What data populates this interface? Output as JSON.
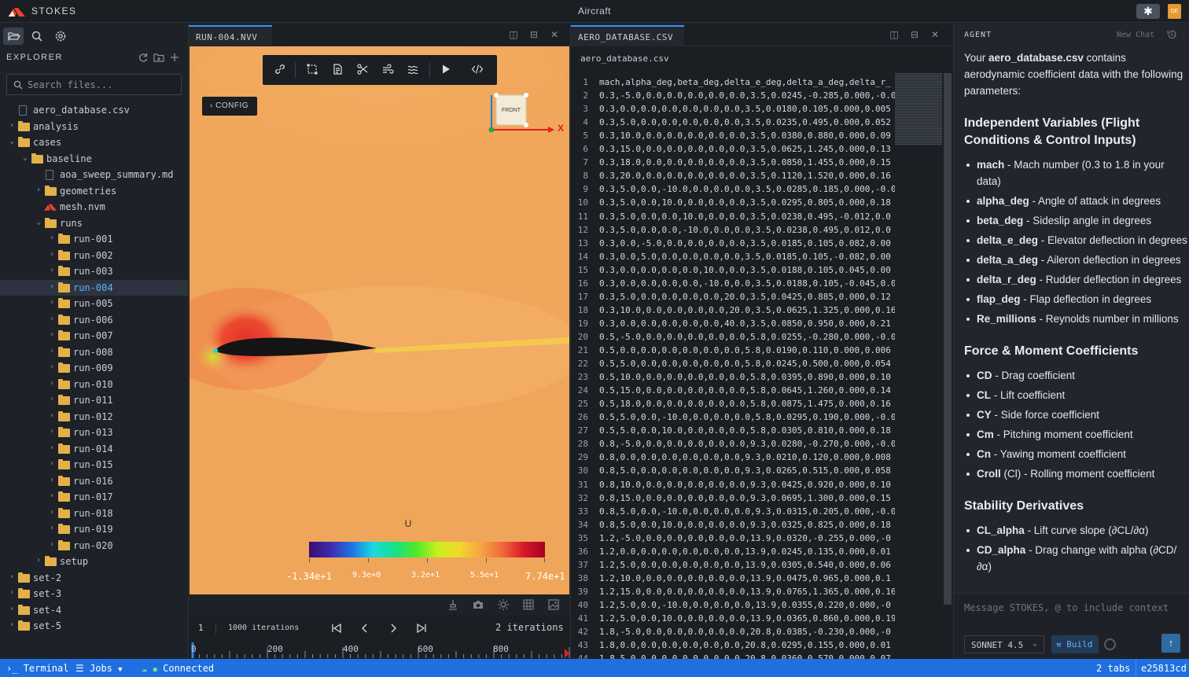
{
  "app": {
    "brand": "STOKES",
    "window_title": "Aircraft",
    "user_initials": "DE",
    "star_icon": "✱"
  },
  "sidebar": {
    "tabs": [
      {
        "icon": "folder-open-icon"
      },
      {
        "icon": "search-icon"
      },
      {
        "icon": "gear-icon"
      }
    ],
    "explorer_title": "EXPLORER",
    "search_placeholder": "Search files...",
    "tree": [
      {
        "label": "aero_database.csv",
        "type": "file",
        "depth": 0
      },
      {
        "label": "analysis",
        "type": "folder",
        "depth": 0,
        "expanded": false
      },
      {
        "label": "cases",
        "type": "folder",
        "depth": 0,
        "expanded": true
      },
      {
        "label": "baseline",
        "type": "folder",
        "depth": 1,
        "expanded": true
      },
      {
        "label": "aoa_sweep_summary.md",
        "type": "file",
        "depth": 2
      },
      {
        "label": "geometries",
        "type": "folder",
        "depth": 2,
        "expanded": false
      },
      {
        "label": "mesh.nvm",
        "type": "mesh",
        "depth": 2
      },
      {
        "label": "runs",
        "type": "folder",
        "depth": 2,
        "expanded": true
      },
      {
        "label": "run-001",
        "type": "folder",
        "depth": 3
      },
      {
        "label": "run-002",
        "type": "folder",
        "depth": 3
      },
      {
        "label": "run-003",
        "type": "folder",
        "depth": 3
      },
      {
        "label": "run-004",
        "type": "folder",
        "depth": 3,
        "selected": true
      },
      {
        "label": "run-005",
        "type": "folder",
        "depth": 3
      },
      {
        "label": "run-006",
        "type": "folder",
        "depth": 3
      },
      {
        "label": "run-007",
        "type": "folder",
        "depth": 3
      },
      {
        "label": "run-008",
        "type": "folder",
        "depth": 3
      },
      {
        "label": "run-009",
        "type": "folder",
        "depth": 3
      },
      {
        "label": "run-010",
        "type": "folder",
        "depth": 3
      },
      {
        "label": "run-011",
        "type": "folder",
        "depth": 3
      },
      {
        "label": "run-012",
        "type": "folder",
        "depth": 3
      },
      {
        "label": "run-013",
        "type": "folder",
        "depth": 3
      },
      {
        "label": "run-014",
        "type": "folder",
        "depth": 3
      },
      {
        "label": "run-015",
        "type": "folder",
        "depth": 3
      },
      {
        "label": "run-016",
        "type": "folder",
        "depth": 3
      },
      {
        "label": "run-017",
        "type": "folder",
        "depth": 3
      },
      {
        "label": "run-018",
        "type": "folder",
        "depth": 3
      },
      {
        "label": "run-019",
        "type": "folder",
        "depth": 3
      },
      {
        "label": "run-020",
        "type": "folder",
        "depth": 3
      },
      {
        "label": "setup",
        "type": "folder",
        "depth": 2
      },
      {
        "label": "set-2",
        "type": "folder",
        "depth": 0
      },
      {
        "label": "set-3",
        "type": "folder",
        "depth": 0
      },
      {
        "label": "set-4",
        "type": "folder",
        "depth": 0
      },
      {
        "label": "set-5",
        "type": "folder",
        "depth": 0
      }
    ]
  },
  "viewer": {
    "tab_label": "RUN-004.NVV",
    "config_label": "CONFIG",
    "gizmo_face": "FRONT",
    "gizmo_axis": "X",
    "colorbar": {
      "title": "U",
      "ticks": [
        "-1.34e+1",
        "9.3e+0",
        "3.2e+1",
        "5.5e+1",
        "7.74e+1"
      ]
    },
    "timeline": {
      "frame": "1",
      "total": "1000 iterations",
      "iters": "2 iterations",
      "ruler": [
        "0",
        "200",
        "400",
        "600",
        "800"
      ],
      "progress": 0.001
    }
  },
  "csv": {
    "tab_label": "AERO_DATABASE.CSV",
    "file_name": "aero_database.csv",
    "lines": [
      "mach,alpha_deg,beta_deg,delta_e_deg,delta_a_deg,delta_r_",
      "0.3,-5.0,0.0,0.0,0.0,0.0,0.0,3.5,0.0245,-0.285,0.000,-0.0",
      "0.3,0.0,0.0,0.0,0.0,0.0,0.0,3.5,0.0180,0.105,0.000,0.005",
      "0.3,5.0,0.0,0.0,0.0,0.0,0.0,3.5,0.0235,0.495,0.000,0.052",
      "0.3,10.0,0.0,0.0,0.0,0.0,0.0,3.5,0.0380,0.880,0.000,0.09",
      "0.3,15.0,0.0,0.0,0.0,0.0,0.0,3.5,0.0625,1.245,0.000,0.13",
      "0.3,18.0,0.0,0.0,0.0,0.0,0.0,3.5,0.0850,1.455,0.000,0.15",
      "0.3,20.0,0.0,0.0,0.0,0.0,0.0,3.5,0.1120,1.520,0.000,0.16",
      "0.3,5.0,0.0,-10.0,0.0,0.0,0.0,3.5,0.0285,0.185,0.000,-0.0",
      "0.3,5.0,0.0,10.0,0.0,0.0,0.0,3.5,0.0295,0.805,0.000,0.18",
      "0.3,5.0,0.0,0.0,10.0,0.0,0.0,3.5,0.0238,0.495,-0.012,0.0",
      "0.3,5.0,0.0,0.0,-10.0,0.0,0.0,3.5,0.0238,0.495,0.012,0.0",
      "0.3,0.0,-5.0,0.0,0.0,0.0,0.0,3.5,0.0185,0.105,0.082,0.00",
      "0.3,0.0,5.0,0.0,0.0,0.0,0.0,3.5,0.0185,0.105,-0.082,0.00",
      "0.3,0.0,0.0,0.0,0.0,10.0,0.0,3.5,0.0188,0.105,0.045,0.00",
      "0.3,0.0,0.0,0.0,0.0,-10.0,0.0,3.5,0.0188,0.105,-0.045,0.0",
      "0.3,5.0,0.0,0.0,0.0,0.0,20.0,3.5,0.0425,0.885,0.000,0.12",
      "0.3,10.0,0.0,0.0,0.0,0.0,20.0,3.5,0.0625,1.325,0.000,0.16",
      "0.3,0.0,0.0,0.0,0.0,0.0,40.0,3.5,0.0850,0.950,0.000,0.21",
      "0.5,-5.0,0.0,0.0,0.0,0.0,0.0,5.8,0.0255,-0.280,0.000,-0.0",
      "0.5,0.0,0.0,0.0,0.0,0.0,0.0,5.8,0.0190,0.110,0.000,0.006",
      "0.5,5.0,0.0,0.0,0.0,0.0,0.0,5.8,0.0245,0.500,0.000,0.054",
      "0.5,10.0,0.0,0.0,0.0,0.0,0.0,5.8,0.0395,0.890,0.000,0.10",
      "0.5,15.0,0.0,0.0,0.0,0.0,0.0,5.8,0.0645,1.260,0.000,0.14",
      "0.5,18.0,0.0,0.0,0.0,0.0,0.0,5.8,0.0875,1.475,0.000,0.16",
      "0.5,5.0,0.0,-10.0,0.0,0.0,0.0,5.8,0.0295,0.190,0.000,-0.0",
      "0.5,5.0,0.0,10.0,0.0,0.0,0.0,5.8,0.0305,0.810,0.000,0.18",
      "0.8,-5.0,0.0,0.0,0.0,0.0,0.0,9.3,0.0280,-0.270,0.000,-0.0",
      "0.8,0.0,0.0,0.0,0.0,0.0,0.0,9.3,0.0210,0.120,0.000,0.008",
      "0.8,5.0,0.0,0.0,0.0,0.0,0.0,9.3,0.0265,0.515,0.000,0.058",
      "0.8,10.0,0.0,0.0,0.0,0.0,0.0,9.3,0.0425,0.920,0.000,0.10",
      "0.8,15.0,0.0,0.0,0.0,0.0,0.0,9.3,0.0695,1.300,0.000,0.15",
      "0.8,5.0,0.0,-10.0,0.0,0.0,0.0,9.3,0.0315,0.205,0.000,-0.0",
      "0.8,5.0,0.0,10.0,0.0,0.0,0.0,9.3,0.0325,0.825,0.000,0.18",
      "1.2,-5.0,0.0,0.0,0.0,0.0,0.0,13.9,0.0320,-0.255,0.000,-0",
      "1.2,0.0,0.0,0.0,0.0,0.0,0.0,13.9,0.0245,0.135,0.000,0.01",
      "1.2,5.0,0.0,0.0,0.0,0.0,0.0,13.9,0.0305,0.540,0.000,0.06",
      "1.2,10.0,0.0,0.0,0.0,0.0,0.0,13.9,0.0475,0.965,0.000,0.1",
      "1.2,15.0,0.0,0.0,0.0,0.0,0.0,13.9,0.0765,1.365,0.000,0.16",
      "1.2,5.0,0.0,-10.0,0.0,0.0,0.0,13.9,0.0355,0.220,0.000,-0",
      "1.2,5.0,0.0,10.0,0.0,0.0,0.0,13.9,0.0365,0.860,0.000,0.19",
      "1.8,-5.0,0.0,0.0,0.0,0.0,0.0,20.8,0.0385,-0.230,0.000,-0",
      "1.8,0.0,0.0,0.0,0.0,0.0,0.0,20.8,0.0295,0.155,0.000,0.01",
      "1.8,5.0,0.0,0.0,0.0,0.0,0.0,20.8,0.0360,0.570,0.000,0.07"
    ]
  },
  "agent": {
    "title": "AGENT",
    "new_chat": "New Chat",
    "intro_pre": "Your ",
    "intro_file": "aero_database.csv",
    "intro_post": " contains aerodynamic coefficient data with the following parameters:",
    "sections": [
      {
        "heading": "Independent Variables (Flight Conditions & Control Inputs)",
        "items": [
          {
            "term": "mach",
            "desc": " - Mach number (0.3 to 1.8 in your data)"
          },
          {
            "term": "alpha_deg",
            "desc": " - Angle of attack in degrees"
          },
          {
            "term": "beta_deg",
            "desc": " - Sideslip angle in degrees"
          },
          {
            "term": "delta_e_deg",
            "desc": " - Elevator deflection in degrees"
          },
          {
            "term": "delta_a_deg",
            "desc": " - Aileron deflection in degrees"
          },
          {
            "term": "delta_r_deg",
            "desc": " - Rudder deflection in degrees"
          },
          {
            "term": "flap_deg",
            "desc": " - Flap deflection in degrees"
          },
          {
            "term": "Re_millions",
            "desc": " - Reynolds number in millions"
          }
        ]
      },
      {
        "heading": "Force & Moment Coefficients",
        "items": [
          {
            "term": "CD",
            "desc": " - Drag coefficient"
          },
          {
            "term": "CL",
            "desc": " - Lift coefficient"
          },
          {
            "term": "CY",
            "desc": " - Side force coefficient"
          },
          {
            "term": "Cm",
            "desc": " - Pitching moment coefficient"
          },
          {
            "term": "Cn",
            "desc": " - Yawing moment coefficient"
          },
          {
            "term": "Croll",
            "desc": " (Cl) - Rolling moment coefficient"
          }
        ]
      },
      {
        "heading": "Stability Derivatives",
        "items": [
          {
            "term": "CL_alpha",
            "desc": " - Lift curve slope (∂CL/∂α)"
          },
          {
            "term": "CD_alpha",
            "desc": " - Drag change with alpha (∂CD/∂α)"
          }
        ]
      }
    ],
    "input_placeholder": "Message STOKES, @ to include context",
    "model": "SONNET 4.5",
    "build_label": "Build",
    "send_icon": "↑"
  },
  "status": {
    "terminal": "Terminal",
    "jobs": "Jobs",
    "connected": "Connected",
    "tabs": "2 tabs",
    "commit": "e25813cd"
  },
  "colors": {
    "accent": "#1f6fe0",
    "selection": "#5fb4ff",
    "folder": "#e3b14a",
    "brand_red": "#e8412c"
  }
}
